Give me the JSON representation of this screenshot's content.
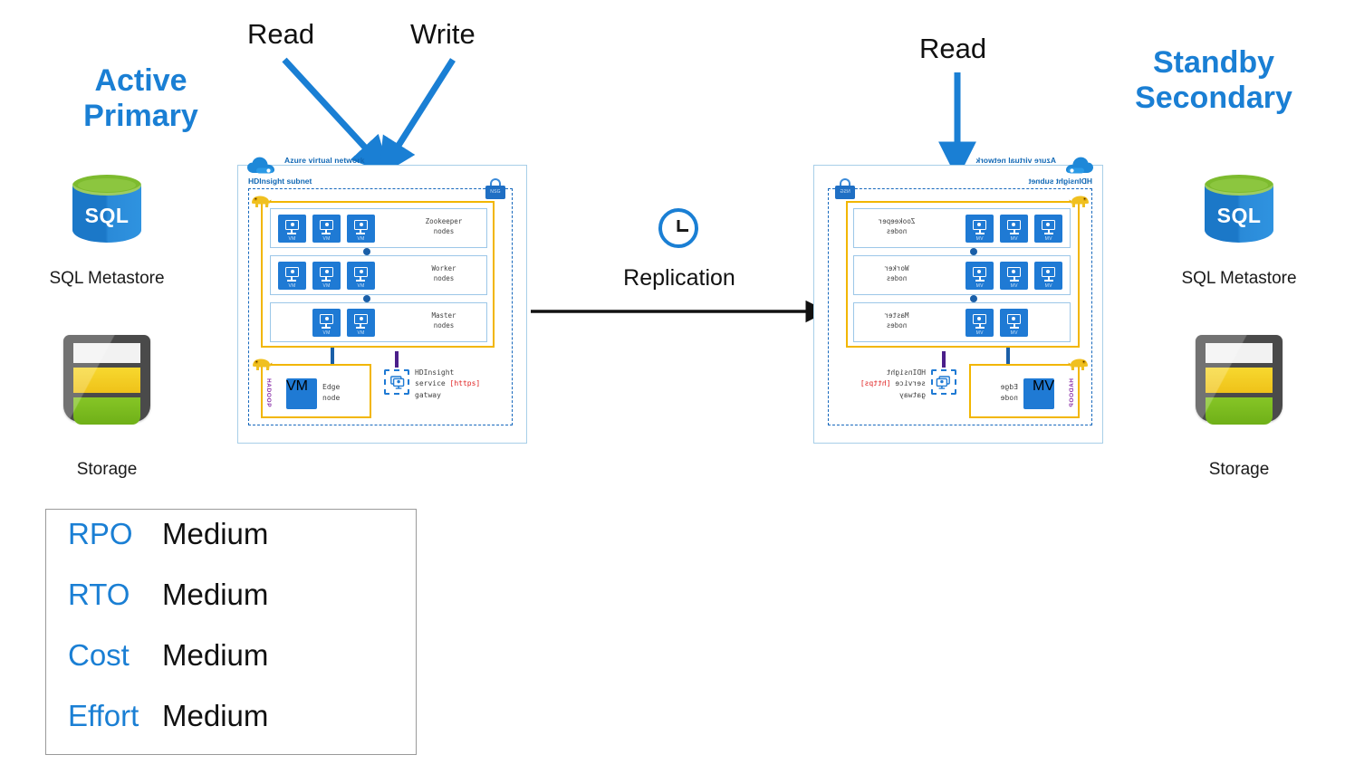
{
  "left_side": {
    "title": "Active\nPrimary",
    "title_line1": "Active",
    "title_line2": "Primary",
    "sql_icon_text": "SQL",
    "sql_caption": "SQL Metastore",
    "storage_caption": "Storage"
  },
  "right_side": {
    "title_line1": "Standby",
    "title_line2": "Secondary",
    "sql_icon_text": "SQL",
    "sql_caption": "SQL Metastore",
    "storage_caption": "Storage"
  },
  "flows": {
    "read_left": "Read",
    "write_left": "Write",
    "read_right": "Read",
    "replication_label": "Replication",
    "clock_icon": "clock-icon"
  },
  "cluster": {
    "vnet_label": "Azure virtual network",
    "subnet_label": "HDInsight subnet",
    "nsg_label": "NSG",
    "hadoop_label": "HADOOP",
    "node_groups": [
      {
        "label_line1": "Zookeeper",
        "label_line2": "nodes",
        "vm_count": 3,
        "vm_label": "VM"
      },
      {
        "label_line1": "Worker",
        "label_line2": "nodes",
        "vm_count": 3,
        "vm_label": "VM"
      },
      {
        "label_line1": "Master",
        "label_line2": "nodes",
        "vm_count": 2,
        "vm_label": "VM"
      }
    ],
    "edge": {
      "label_line1": "Edge",
      "label_line2": "node",
      "vm_label": "VM"
    },
    "gateway": {
      "line1": "HDInsight",
      "line2_pre": "service ",
      "line2_https": "[https]",
      "line3": "gatway"
    }
  },
  "metrics": {
    "rows": [
      {
        "key": "RPO",
        "value": "Medium"
      },
      {
        "key": "RTO",
        "value": "Medium"
      },
      {
        "key": "Cost",
        "value": "Medium"
      },
      {
        "key": "Effort",
        "value": "Medium"
      }
    ]
  },
  "colors": {
    "accent_blue": "#1a7fd4",
    "azure_blue": "#1168b5",
    "vm_blue": "#1f7ad4",
    "yellow_border": "#f2b600",
    "hadoop_purple": "#8a2fa8",
    "https_red": "#e02020",
    "sql_green": "#8cc63f",
    "storage_gray": "#4a4a4a"
  }
}
